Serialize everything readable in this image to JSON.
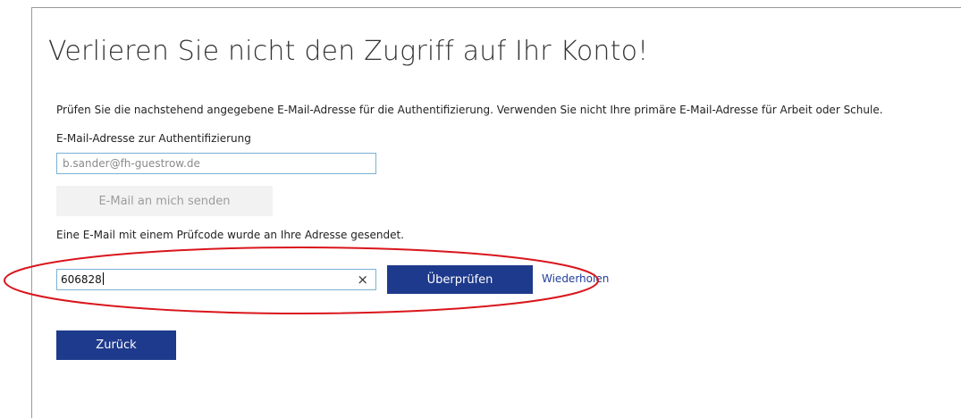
{
  "page": {
    "title": "Verlieren Sie nicht den Zugriff auf Ihr Konto!",
    "intro": "Prüfen Sie die nachstehend angegebene E-Mail-Adresse für die Authentifizierung. Verwenden Sie nicht Ihre primäre E-Mail-Adresse für Arbeit oder Schule."
  },
  "email": {
    "label": "E-Mail-Adresse zur Authentifizierung",
    "value": "b.sander@fh-guestrow.de",
    "send_button": "E-Mail an mich senden"
  },
  "verification": {
    "message": "Eine E-Mail mit einem Prüfcode wurde an Ihre Adresse gesendet.",
    "code_value": "606828",
    "clear_symbol": "×",
    "verify_button": "Überprüfen",
    "retry_link": "Wiederholen"
  },
  "footer": {
    "back_button": "Zurück"
  },
  "colors": {
    "primary_button": "#1e3a8c",
    "link": "#1f3f99",
    "input_border": "#7ab1d4",
    "highlight": "#d9161c"
  }
}
